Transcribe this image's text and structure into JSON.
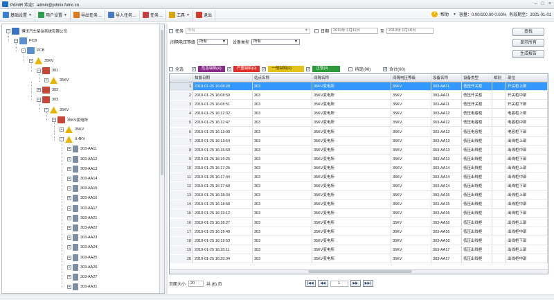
{
  "window": {
    "title": "PdmIR 欢迎：admin@pdmix.fotric.cn",
    "controls": [
      "–",
      "□",
      "×"
    ]
  },
  "menu": {
    "items": [
      {
        "label": "基础设置",
        "color": "#3c7fd0"
      },
      {
        "label": "用户设置",
        "color": "#2e9e4f"
      },
      {
        "label": "导出任务…",
        "color": "#e07b1a"
      },
      {
        "label": "导入任务…",
        "color": "#4a78c8"
      },
      {
        "label": "任务…",
        "color": "#c94040"
      },
      {
        "label": "工具",
        "color": "#d9a300"
      },
      {
        "label": "退出",
        "color": "#d23b2b"
      }
    ],
    "right": {
      "help": "帮助",
      "quota": "容量：0.00/100.00 0.00%",
      "validity": "有效期至：2021-01-01"
    }
  },
  "tree": {
    "nodes": [
      {
        "label": "博世汽车柴油系统有限公司",
        "level": 0,
        "expander": "−",
        "icon": "company-icon",
        "color": "#3a73c4"
      },
      {
        "label": "PCB",
        "level": 1,
        "expander": "−",
        "icon": "building-icon",
        "color": "#5a8fd0"
      },
      {
        "label": "PCB",
        "level": 2,
        "expander": "−",
        "icon": "building-icon",
        "color": "#5a8fd0"
      },
      {
        "label": "35KV",
        "level": 3,
        "expander": "−",
        "icon": "warning-icon",
        "color": "#e8b400"
      },
      {
        "label": "301",
        "level": 4,
        "expander": "−",
        "icon": "substation-icon",
        "color": "#c8453a"
      },
      {
        "label": "35KV",
        "level": 5,
        "expander": "+",
        "icon": "warning-icon",
        "color": "#e8b400"
      },
      {
        "label": "302",
        "level": 4,
        "expander": "+",
        "icon": "substation-icon",
        "color": "#c8453a"
      },
      {
        "label": "303",
        "level": 4,
        "expander": "−",
        "icon": "substation-icon",
        "color": "#c8453a"
      },
      {
        "label": "35KV",
        "level": 5,
        "expander": "−",
        "icon": "warning-icon",
        "color": "#e8b400"
      },
      {
        "label": "35KV变电所",
        "level": 6,
        "expander": "−",
        "icon": "substation-icon",
        "color": "#c8453a"
      },
      {
        "label": "35KV",
        "level": 7,
        "expander": "+",
        "icon": "warning-icon",
        "color": "#e8b400"
      },
      {
        "label": "0.4KV",
        "level": 7,
        "expander": "−",
        "icon": "warning-icon",
        "color": "#e8b400"
      },
      {
        "label": "303-AA11",
        "level": 8,
        "expander": "+",
        "icon": "cabinet-icon",
        "color": "#7a8ea6"
      },
      {
        "label": "303-AA12",
        "level": 8,
        "expander": "+",
        "icon": "cabinet-icon",
        "color": "#7a8ea6"
      },
      {
        "label": "303-AA13",
        "level": 8,
        "expander": "+",
        "icon": "cabinet-icon",
        "color": "#7a8ea6"
      },
      {
        "label": "303-AA14",
        "level": 8,
        "expander": "+",
        "icon": "cabinet-icon",
        "color": "#7a8ea6"
      },
      {
        "label": "303-AA15",
        "level": 8,
        "expander": "+",
        "icon": "cabinet-icon",
        "color": "#7a8ea6"
      },
      {
        "label": "303-AA16",
        "level": 8,
        "expander": "+",
        "icon": "cabinet-icon",
        "color": "#7a8ea6"
      },
      {
        "label": "303-AA17",
        "level": 8,
        "expander": "+",
        "icon": "cabinet-icon",
        "color": "#7a8ea6"
      },
      {
        "label": "303-AA21",
        "level": 8,
        "expander": "+",
        "icon": "cabinet-icon",
        "color": "#7a8ea6"
      },
      {
        "label": "303-AA22",
        "level": 8,
        "expander": "+",
        "icon": "cabinet-icon",
        "color": "#7a8ea6"
      },
      {
        "label": "303-AA23",
        "level": 8,
        "expander": "+",
        "icon": "cabinet-icon",
        "color": "#7a8ea6"
      },
      {
        "label": "303-AA24",
        "level": 8,
        "expander": "+",
        "icon": "cabinet-icon",
        "color": "#7a8ea6"
      },
      {
        "label": "303-AA25",
        "level": 8,
        "expander": "+",
        "icon": "cabinet-icon",
        "color": "#7a8ea6"
      },
      {
        "label": "303-AA26",
        "level": 8,
        "expander": "+",
        "icon": "cabinet-icon",
        "color": "#7a8ea6"
      },
      {
        "label": "303-AA27",
        "level": 8,
        "expander": "+",
        "icon": "cabinet-icon",
        "color": "#7a8ea6"
      },
      {
        "label": "303-AA31",
        "level": 8,
        "expander": "+",
        "icon": "cabinet-icon",
        "color": "#7a8ea6"
      }
    ]
  },
  "filters": {
    "task_label": "任务",
    "task_value": "所有",
    "date_label": "日期",
    "date_from": "2019年 1月11日",
    "date_sep": "至",
    "date_to": "2019年 1月18日",
    "voltage_label": "间隔电压等级",
    "voltage_value": "所有",
    "device_type_label": "设备类型",
    "device_type_value": "所有",
    "find_button": "查找",
    "show_all_button": "显示所有",
    "report_button": "生成报告"
  },
  "legend": {
    "select_all": "全选",
    "badges": [
      {
        "label": "危急缺陷(0)",
        "color": "#8a2b8a"
      },
      {
        "label": "严重缺陷(0)",
        "color": "#e0322a"
      },
      {
        "label": "一般缺陷(0)",
        "color": "#e3c21a"
      },
      {
        "label": "正常(0)",
        "color": "#2c9a3a"
      }
    ],
    "pending_label": "待定(00)",
    "total_label": "合计(00)"
  },
  "grid": {
    "columns": [
      "",
      "拍摄日期",
      "站点名称",
      "间隔名称",
      "间隔电压等级",
      "设备名称",
      "设备类型",
      "相别",
      "部位"
    ],
    "rows": [
      [
        "1",
        "2019-01-25 16:08:28",
        "303",
        "35KV变电所",
        "35KV",
        "303-AA11",
        "低压开关柜",
        "",
        "开关柜上部"
      ],
      [
        "2",
        "2019-01-25 16:08:59",
        "303",
        "35KV变电所",
        "35KV",
        "303-AA11",
        "低压开关柜",
        "",
        "开关柜中部"
      ],
      [
        "3",
        "2019-01-25 16:08:51",
        "303",
        "35KV变电所",
        "35KV",
        "303-AA11",
        "低压开关柜",
        "",
        "开关柜下部"
      ],
      [
        "4",
        "2019-01-25 16:12:32",
        "303",
        "35KV变电所",
        "35KV",
        "303-AA12",
        "低压电容柜",
        "",
        "电容柜上部"
      ],
      [
        "5",
        "2019-01-25 16:12:47",
        "303",
        "35KV变电所",
        "35KV",
        "303-AA12",
        "低压电容柜",
        "",
        "电容柜中部"
      ],
      [
        "6",
        "2019-01-25 16:13:00",
        "303",
        "35KV变电所",
        "35KV",
        "303-AA12",
        "低压电容柜",
        "",
        "电容柜下部"
      ],
      [
        "7",
        "2019-01-25 16:13:54",
        "303",
        "35KV变电所",
        "35KV",
        "303-AA13",
        "低压出线柜",
        "",
        "出线柜上部"
      ],
      [
        "8",
        "2019-01-25 16:15:59",
        "303",
        "35KV变电所",
        "35KV",
        "303-AA13",
        "低压出线柜",
        "",
        "出线柜中部"
      ],
      [
        "9",
        "2019-01-25 16:16:25",
        "303",
        "35KV变电所",
        "35KV",
        "303-AA13",
        "低压出线柜",
        "",
        "出线柜下部"
      ],
      [
        "10",
        "2019-01-25 16:17:25",
        "303",
        "35KV变电所",
        "35KV",
        "303-AA14",
        "低压出线柜",
        "",
        "出线柜上部"
      ],
      [
        "11",
        "2019-01-25 16:17:44",
        "303",
        "35KV变电所",
        "35KV",
        "303-AA14",
        "低压出线柜",
        "",
        "出线柜中部"
      ],
      [
        "12",
        "2019-01-25 16:17:58",
        "303",
        "35KV变电所",
        "35KV",
        "303-AA14",
        "低压出线柜",
        "",
        "出线柜下部"
      ],
      [
        "13",
        "2019-01-25 16:18:34",
        "303",
        "35KV变电所",
        "35KV",
        "303-AA15",
        "低压出线柜",
        "",
        "出线柜上部"
      ],
      [
        "14",
        "2019-01-25 16:18:58",
        "303",
        "35KV变电所",
        "35KV",
        "303-AA15",
        "低压出线柜",
        "",
        "出线柜中部"
      ],
      [
        "15",
        "2019-01-25 16:19:12",
        "303",
        "35KV变电所",
        "35KV",
        "303-AA15",
        "低压出线柜",
        "",
        "出线柜下部"
      ],
      [
        "16",
        "2019-01-25 16:18:27",
        "303",
        "35KV变电所",
        "35KV",
        "303-AA16",
        "低压出线柜",
        "",
        "出线柜上部"
      ],
      [
        "17",
        "2019-01-25 16:19:40",
        "303",
        "35KV变电所",
        "35KV",
        "303-AA16",
        "低压出线柜",
        "",
        "出线柜中部"
      ],
      [
        "18",
        "2019-01-25 16:19:53",
        "303",
        "35KV变电所",
        "35KV",
        "303-AA16",
        "低压出线柜",
        "",
        "出线柜下部"
      ],
      [
        "19",
        "2019-01-25 16:20:11",
        "303",
        "35KV变电所",
        "35KV",
        "303-AA17",
        "低压出线柜",
        "",
        "出线柜上部"
      ],
      [
        "20",
        "2019-01-25 16:20:34",
        "303",
        "35KV变电所",
        "35KV",
        "303-AA17",
        "低压出线柜",
        "",
        "出线柜中部"
      ]
    ],
    "selected_row": 0
  },
  "pager": {
    "page_size_label": "页面大小",
    "page_size_value": "20",
    "total_label": "共 (6) 页",
    "current_page": "1",
    "first": "|◀◀",
    "prev": "◀◀",
    "next": "▶▶",
    "last": "▶▶|"
  }
}
